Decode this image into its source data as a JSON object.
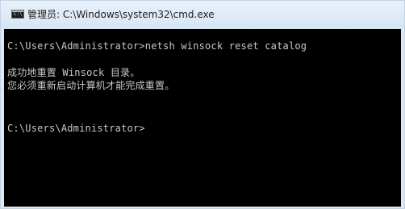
{
  "window": {
    "title": "管理员: C:\\Windows\\system32\\cmd.exe",
    "icon": "cmd-icon"
  },
  "console": {
    "lines": [
      "C:\\Users\\Administrator>netsh winsock reset catalog",
      "成功地重置 Winsock 目录。",
      "您必须重新启动计算机才能完成重置。",
      "C:\\Users\\Administrator>"
    ]
  },
  "colors": {
    "console_bg": "#000000",
    "console_text": "#c8c8c8",
    "titlebar": "#dbe8f5"
  }
}
